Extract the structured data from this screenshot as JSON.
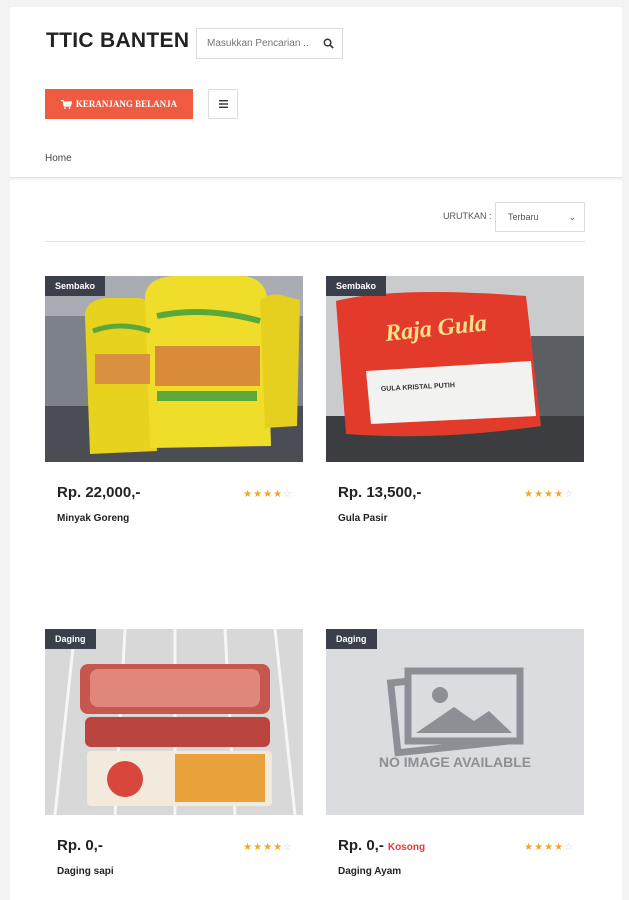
{
  "header": {
    "brand": "TTIC BANTEN",
    "search_placeholder": "Masukkan Pencarian ..",
    "cart_label": "KERANJANG BELANJA",
    "breadcrumb": "Home"
  },
  "sort": {
    "label": "URUTKAN :",
    "selected": "Terbaru"
  },
  "products": [
    {
      "category": "Sembako",
      "price": "Rp. 22,000,-",
      "name": "Minyak Goreng",
      "stock_status": "",
      "rating": 4,
      "rating_max": 5
    },
    {
      "category": "Sembako",
      "price": "Rp. 13,500,-",
      "name": "Gula Pasir",
      "stock_status": "",
      "rating": 4,
      "rating_max": 5
    },
    {
      "category": "Daging",
      "price": "Rp. 0,-",
      "name": "Daging sapi",
      "stock_status": "",
      "rating": 4,
      "rating_max": 5
    },
    {
      "category": "Daging",
      "price": "Rp. 0,-",
      "name": "Daging Ayam",
      "stock_status": "Kosong",
      "rating": 4,
      "rating_max": 5,
      "image_text": "NO IMAGE AVAILABLE"
    }
  ],
  "colors": {
    "accent": "#ef5b41",
    "badge": "#3a3f4b",
    "star": "#f4a623",
    "out_of_stock": "#e53935"
  }
}
